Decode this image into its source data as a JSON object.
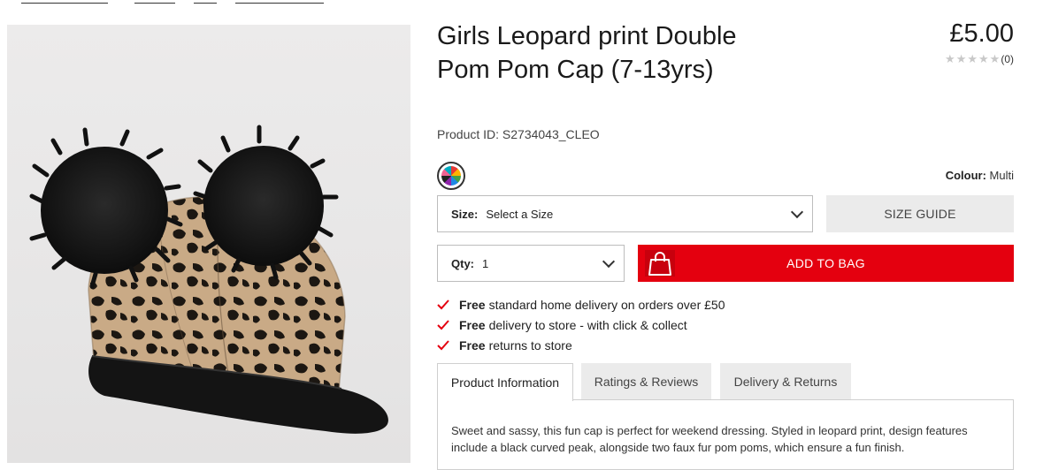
{
  "product": {
    "title": "Girls Leopard print Double Pom Pom Cap (7-13yrs)",
    "price": "£5.00",
    "rating_stars": "★★★★★",
    "rating_count": "(0)",
    "product_id": "Product ID: S2734043_CLEO",
    "colour_label": "Colour:",
    "colour_value": "Multi"
  },
  "size": {
    "label": "Size:",
    "value": "Select a Size"
  },
  "size_guide": "SIZE GUIDE",
  "qty": {
    "label": "Qty:",
    "value": "1"
  },
  "add_to_bag": "ADD TO BAG",
  "benefits": [
    {
      "bold": "Free",
      "text": "standard home delivery on orders over £50"
    },
    {
      "bold": "Free",
      "text": "delivery to store - with click & collect"
    },
    {
      "bold": "Free",
      "text": "returns to store"
    }
  ],
  "tabs": [
    "Product Information",
    "Ratings & Reviews",
    "Delivery & Returns"
  ],
  "description": "Sweet and sassy, this fun cap is perfect for weekend dressing. Styled in leopard print, design features include a black curved peak, alongside two faux fur pom poms, which ensure a fun finish.",
  "colors": {
    "accent_red": "#e4000f",
    "tick_red": "#e4000f"
  }
}
